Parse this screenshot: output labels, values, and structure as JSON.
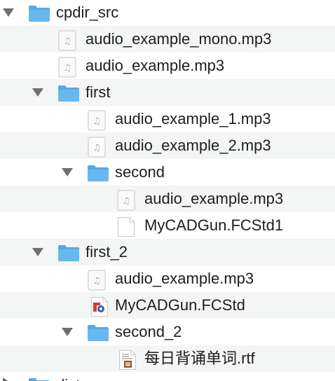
{
  "tree": [
    {
      "label": "cpdir_src",
      "type": "folder",
      "expanded": true,
      "level": 0
    },
    {
      "label": "audio_example_mono.mp3",
      "type": "audio",
      "level": 1
    },
    {
      "label": "audio_example.mp3",
      "type": "audio",
      "level": 1
    },
    {
      "label": "first",
      "type": "folder",
      "expanded": true,
      "level": 1
    },
    {
      "label": "audio_example_1.mp3",
      "type": "audio",
      "level": 2
    },
    {
      "label": "audio_example_2.mp3",
      "type": "audio",
      "level": 2
    },
    {
      "label": "second",
      "type": "folder",
      "expanded": true,
      "level": 2
    },
    {
      "label": "audio_example.mp3",
      "type": "audio",
      "level": 3
    },
    {
      "label": "MyCADGun.FCStd1",
      "type": "blank",
      "level": 3
    },
    {
      "label": "first_2",
      "type": "folder",
      "expanded": true,
      "level": 1
    },
    {
      "label": "audio_example.mp3",
      "type": "audio",
      "level": 2
    },
    {
      "label": "MyCADGun.FCStd",
      "type": "freecad",
      "level": 2
    },
    {
      "label": "second_2",
      "type": "folder",
      "expanded": true,
      "level": 2
    },
    {
      "label": "每日背诵单词.rtf",
      "type": "rtf",
      "level": 3
    },
    {
      "label": "dist",
      "type": "folder",
      "expanded": false,
      "level": 0
    }
  ],
  "colors": {
    "folder": "#67b8ee",
    "folder_tab": "#5aa9e0",
    "stripe": "#f4f5f5"
  }
}
